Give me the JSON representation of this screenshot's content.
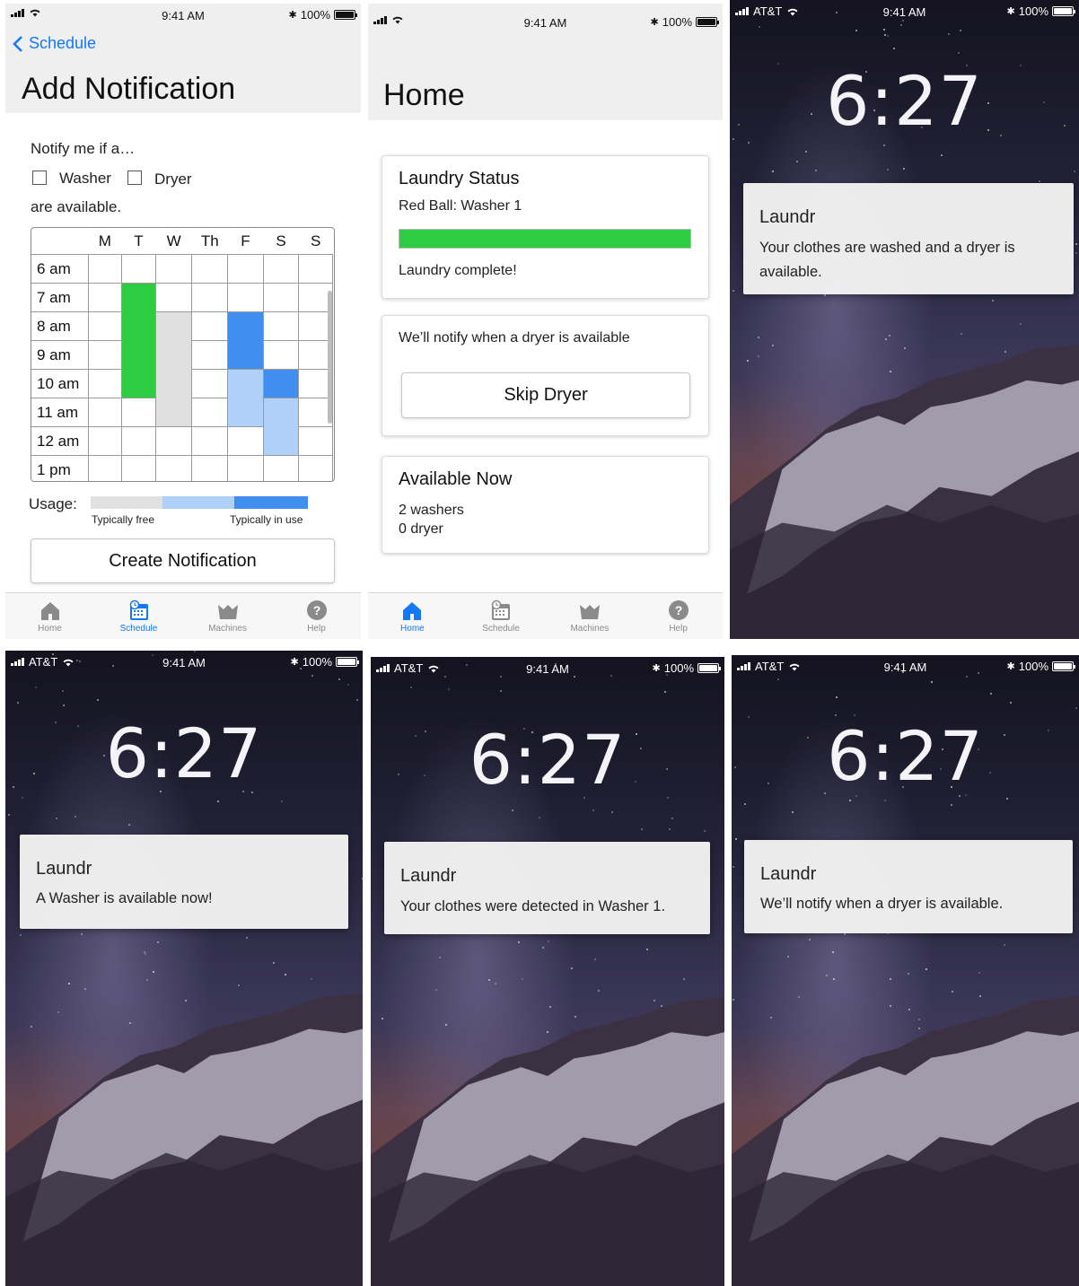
{
  "status_bar": {
    "time": "9:41 AM",
    "battery": "100%",
    "carrier": "AT&T"
  },
  "add_notification": {
    "back_label": "Schedule",
    "title": "Add Notification",
    "notify_prompt": "Notify me if a…",
    "washer_label": "Washer",
    "dryer_label": "Dryer",
    "available_text": "are available.",
    "days": [
      "M",
      "T",
      "W",
      "Th",
      "F",
      "S",
      "S"
    ],
    "times": [
      "6 am",
      "7 am",
      "8 am",
      "9 am",
      "10 am",
      "11 am",
      "12 am",
      "1 pm"
    ],
    "usage_label": "Usage:",
    "legend_free": "Typically free",
    "legend_in_use": "Typically in use",
    "create_button": "Create Notification",
    "colors": {
      "green": "#2ecc40",
      "grey": "#e0e0e0",
      "blue": "#3f8ef0",
      "light_blue": "#aed0f9"
    }
  },
  "home": {
    "title": "Home",
    "laundry_status_title": "Laundry Status",
    "machine_label": "Red Ball: Washer 1",
    "progress_percent": 100,
    "complete_text": "Laundry complete!",
    "notify_text": "We’ll notify when a dryer is available",
    "skip_button": "Skip Dryer",
    "available_title": "Available Now",
    "washers_text": "2 washers",
    "dryer_text": "0 dryer"
  },
  "tabs": [
    "Home",
    "Schedule",
    "Machines",
    "Help"
  ],
  "lock_clock": "6:27",
  "notifications": {
    "app_name": "Laundr",
    "dryer_available": "Your clothes are washed and a dryer is available.",
    "washer_available": "A Washer is available now!",
    "detected": "Your clothes were detected in Washer 1.",
    "will_notify": "We’ll notify when a dryer is available."
  },
  "accent_color": "#1479f6"
}
